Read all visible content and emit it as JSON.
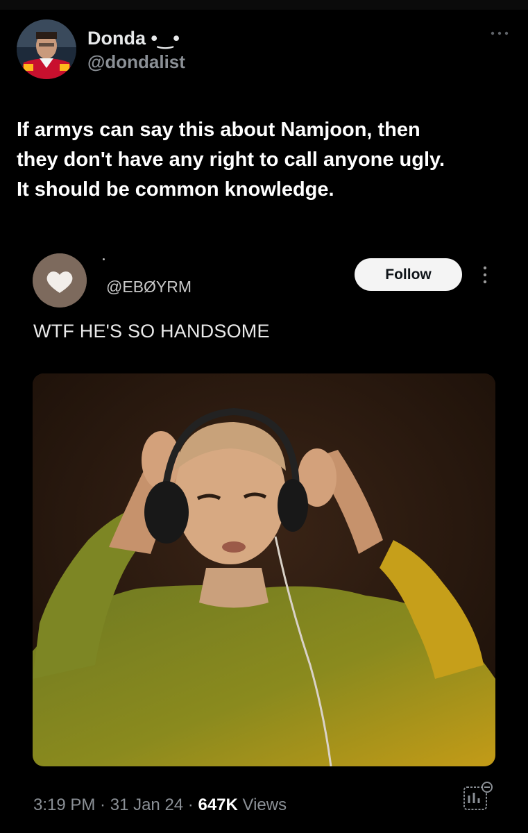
{
  "author": {
    "name": "Donda",
    "name_suffix": " •‿•",
    "handle": "@dondalist"
  },
  "tweet": {
    "lines": [
      "If armys can say this about Namjoon, then",
      "they don't have any right to call anyone ugly.",
      "It should be common knowledge."
    ]
  },
  "embedded_post": {
    "handle": "@EBØYRM",
    "follow_label": "Follow",
    "text": "WTF HE'S SO HANDSOME",
    "avatar_icon": "heart-icon"
  },
  "meta": {
    "time": "3:19 PM",
    "separator": " · ",
    "date": "31 Jan 24",
    "views_count": "647K",
    "views_label": " Views"
  },
  "icons": {
    "more": "more-horizontal-icon",
    "embed_more": "more-vertical-icon",
    "analytics": "analytics-icon"
  },
  "colors": {
    "background": "#000000",
    "text_primary": "#ffffff",
    "text_secondary": "#8b9096",
    "follow_bg": "#f4f4f4"
  }
}
